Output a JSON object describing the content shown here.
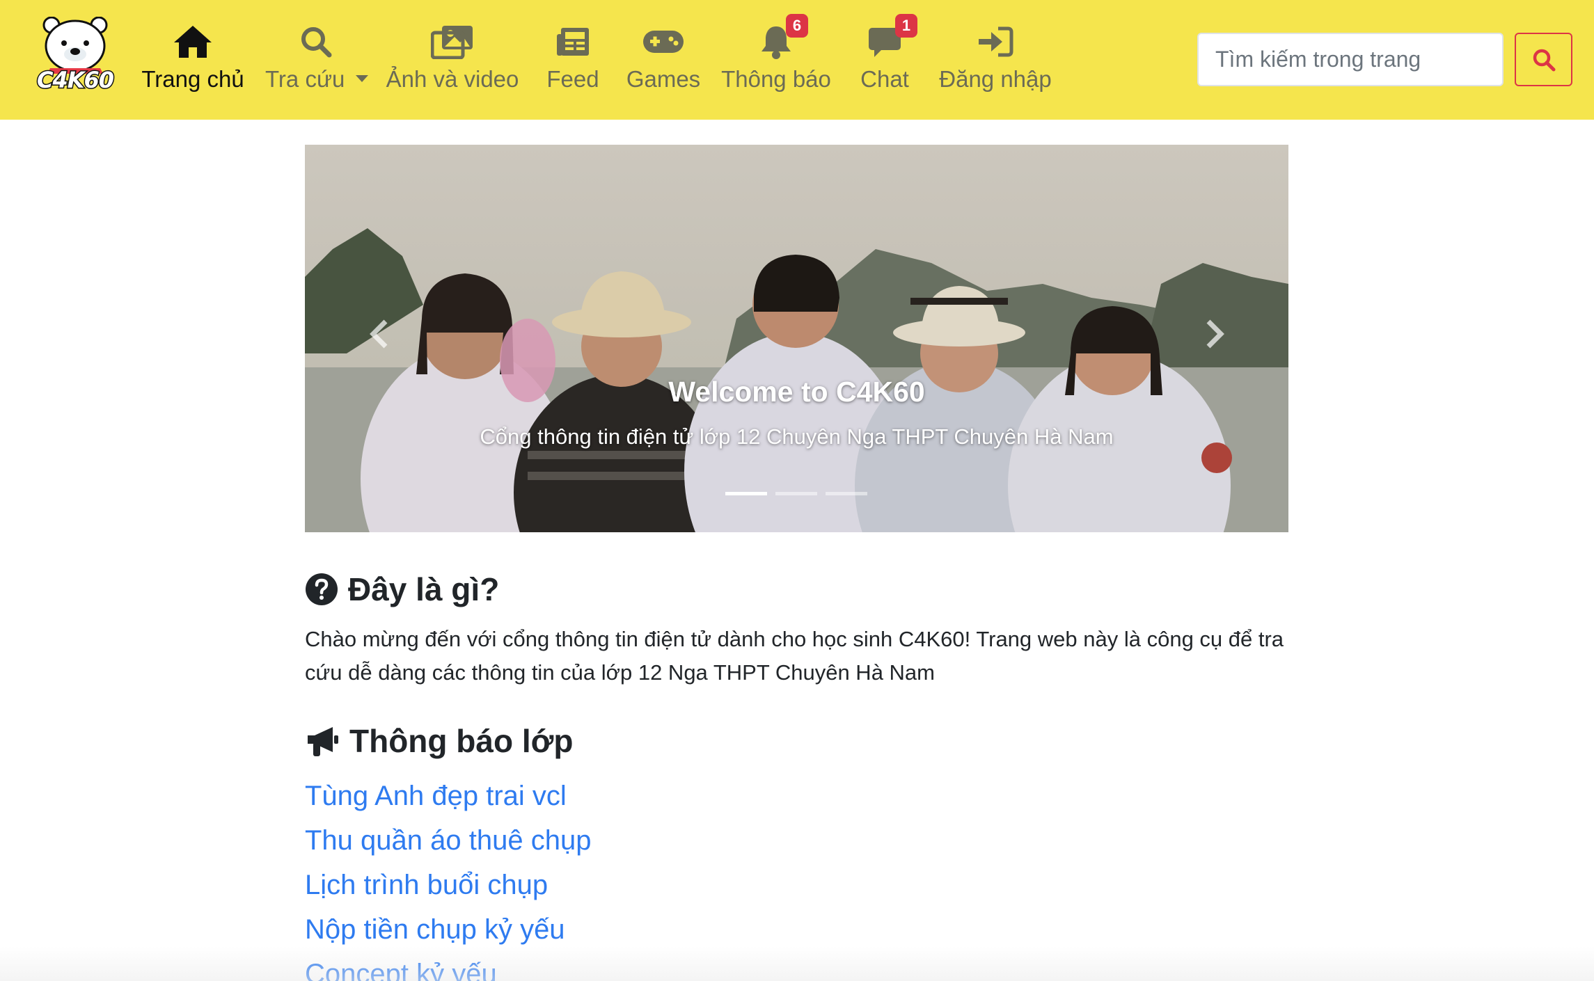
{
  "brand": {
    "logo_text": "C4K60"
  },
  "nav": {
    "home": "Trang chủ",
    "lookup": "Tra cứu",
    "media": "Ảnh và video",
    "feed": "Feed",
    "games": "Games",
    "notifications": "Thông báo",
    "notifications_count": "6",
    "chat": "Chat",
    "chat_count": "1",
    "login": "Đăng nhập"
  },
  "search": {
    "placeholder": "Tìm kiếm trong trang"
  },
  "carousel": {
    "title": "Welcome to C4K60",
    "subtitle": "Cổng thông tin điện tử lớp 12 Chuyên Nga THPT Chuyên Hà Nam",
    "slides": 3,
    "active_slide": 1
  },
  "about": {
    "heading": "Đây là gì?",
    "text": "Chào mừng đến với cổng thông tin điện tử dành cho học sinh C4K60! Trang web này là công cụ để tra cứu dễ dàng các thông tin của lớp 12 Nga THPT Chuyên Hà Nam"
  },
  "announcements": {
    "heading": "Thông báo lớp",
    "items": [
      "Tùng Anh đẹp trai vcl",
      "Thu quần áo thuê chụp",
      "Lịch trình buổi chụp",
      "Nộp tiền chụp kỷ yếu",
      "Concept kỷ yếu"
    ]
  },
  "colors": {
    "navbar_bg": "#f5e54d",
    "link": "#2e7bf0",
    "danger": "#dc3545"
  }
}
